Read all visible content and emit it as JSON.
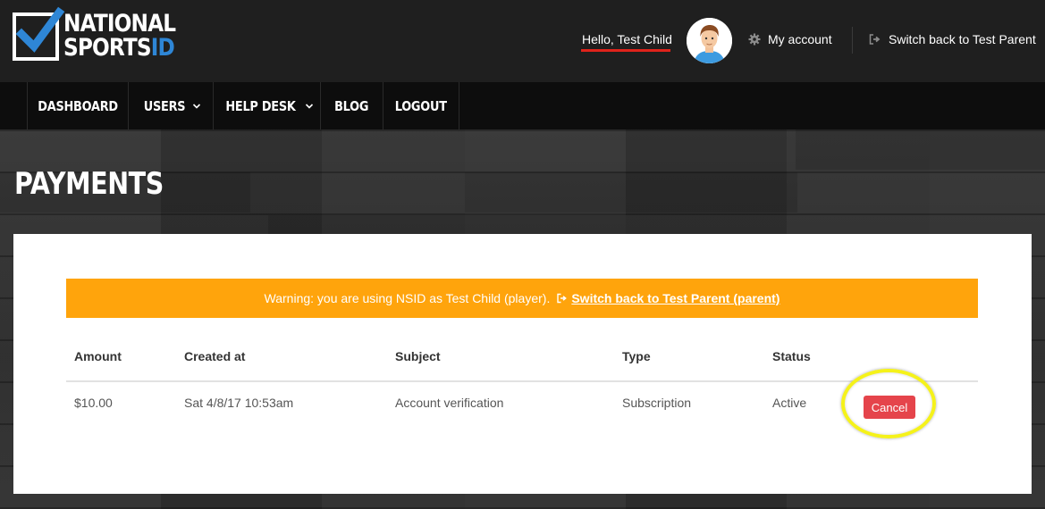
{
  "brand": {
    "logo_line1": "NATIONAL",
    "logo_line2": "SPORTS",
    "logo_line2_accent": "ID"
  },
  "header": {
    "greeting": "Hello, Test Child",
    "my_account_label": "My account",
    "switch_back_label": "Switch back to Test Parent",
    "icons": {
      "my_account": "gear-icon",
      "switch_back": "sign-out-icon"
    }
  },
  "nav": {
    "items": [
      {
        "label": "DASHBOARD"
      },
      {
        "label": "USERS"
      },
      {
        "label": "HELP DESK"
      },
      {
        "label": "BLOG"
      },
      {
        "label": "LOGOUT"
      }
    ]
  },
  "page": {
    "title": "PAYMENTS"
  },
  "warning": {
    "text": "Warning: you are using NSID as Test Child (player).",
    "link_text": "Switch back to Test Parent (parent)",
    "color": "#ffa40c"
  },
  "table": {
    "headers": [
      "Amount",
      "Created at",
      "Subject",
      "Type",
      "Status"
    ],
    "rows": [
      {
        "amount": "$10.00",
        "created_at": "Sat 4/8/17 10:53am",
        "subject": "Account verification",
        "type": "Subscription",
        "status": "Active",
        "action_label": "Cancel"
      }
    ]
  },
  "colors": {
    "accent_red": "#e5444b",
    "highlight": "#f5f21a",
    "brand_blue": "#2e86d6"
  }
}
